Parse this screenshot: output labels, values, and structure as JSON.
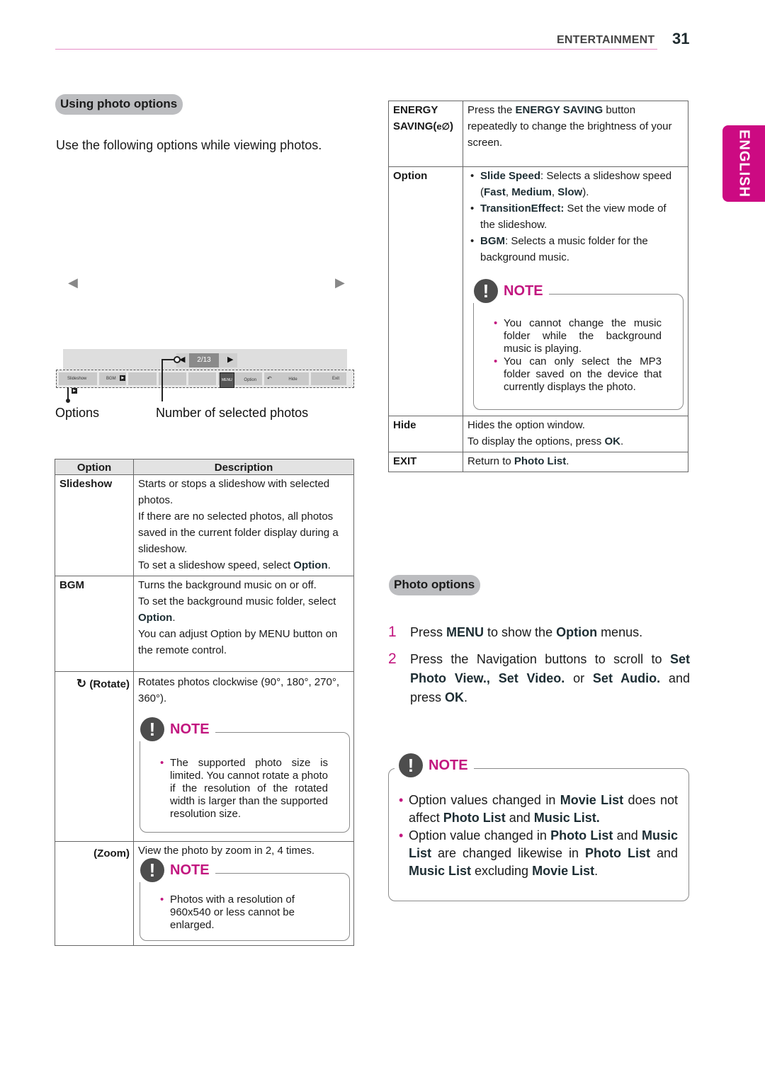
{
  "header": {
    "section": "ENTERTAINMENT",
    "page_number": "31",
    "language_tab": "ENGLISH",
    "accent_color": "#cc0a82"
  },
  "left": {
    "heading": "Using photo options",
    "intro": "Use the following options while viewing photos.",
    "viewer": {
      "prev_icon": "triangle-left",
      "next_icon": "triangle-right",
      "counter": "2/13",
      "osd_buttons": {
        "slideshow": "Slideshow",
        "bgm": "BGM",
        "menu_key": "MENU",
        "option": "Option",
        "hide": "Hide",
        "exit": "Exit"
      },
      "callout_options": "Options",
      "callout_count": "Number of selected photos"
    },
    "table": {
      "headers": [
        "Option",
        "Description"
      ],
      "rows": [
        {
          "option": "Slideshow",
          "lines": [
            "Starts or stops a slideshow with selected photos.",
            "If there are no selected photos, all photos saved in the current folder display during a slideshow.",
            "To set a slideshow speed, select ",
            "Option",
            "."
          ]
        },
        {
          "option": "BGM",
          "lines": [
            "Turns the background music on or off.",
            "To set the background music folder, select ",
            "Option",
            ".",
            "You can adjust Option by MENU button on the remote control."
          ]
        },
        {
          "option": "(Rotate)",
          "icon": "rotate-clockwise",
          "lines": [
            "Rotates photos clockwise (90°, 180°, 270°, 360°)."
          ],
          "note_title": "NOTE",
          "note_items": [
            "The supported photo size is limited. You cannot rotate a photo if the resolution of the rotated width is larger than the supported resolution size."
          ]
        },
        {
          "option": "(Zoom)",
          "lines": [
            "View the photo by zoom in 2, 4 times."
          ],
          "note_title": "NOTE",
          "note_items": [
            "Photos with a resolution of 960x540 or less cannot be enlarged."
          ]
        }
      ]
    }
  },
  "right": {
    "table": {
      "rows": [
        {
          "option_line1": "ENERGY",
          "option_line2": "SAVING(",
          "option_icon": "energy-saving",
          "option_tail": ")",
          "desc_pre": "Press the ",
          "desc_bold": "ENERGY SAVING",
          "desc_post": " button repeatedly to change the brightness of your screen."
        },
        {
          "option": "Option",
          "items": [
            {
              "bold": "Slide Speed",
              "text": ": Selects a slideshow speed (",
              "b1": "Fast",
              "s1": ", ",
              "b2": "Medium",
              "s2": ", ",
              "b3": "Slow",
              "s3": ")."
            },
            {
              "bold": "TransitionEffect:",
              "text": " Set the view mode of the slideshow."
            },
            {
              "bold": "BGM",
              "text": ": Selects a music folder for the background music."
            }
          ],
          "note_title": "NOTE",
          "note_items": [
            "You cannot change the music folder while the background music is playing.",
            "You can only select the MP3 folder saved on the device that currently displays the photo."
          ]
        },
        {
          "option": "Hide",
          "line1": "Hides the option window.",
          "line2_pre": "To display the options, press ",
          "line2_bold": "OK",
          "line2_post": "."
        },
        {
          "option": "EXIT",
          "pre": "Return to ",
          "bold": "Photo List",
          "post": "."
        }
      ]
    },
    "heading": "Photo options",
    "steps": [
      {
        "n": "1",
        "t1": "Press ",
        "b1": "MENU",
        "t2": " to show the ",
        "b2": "Option",
        "t3": " menus."
      },
      {
        "n": "2",
        "t1": "Press the Navigation buttons to scroll to ",
        "b1": "Set Photo View., Set Video.",
        "t2": " or ",
        "b2": "Set Audio.",
        "t3": " and press ",
        "b3": "OK",
        "t4": "."
      }
    ],
    "note": {
      "title": "NOTE",
      "item1": {
        "t1": "Option values changed in ",
        "b1": "Movie List",
        "t2": " does not affect ",
        "b2": "Photo List",
        "t3": " and ",
        "b3": "Music List."
      },
      "item2": {
        "t1": "Option value changed in ",
        "b1": "Photo List",
        "t2": " and ",
        "b2": "Music List",
        "t3": " are changed likewise in ",
        "b3": "Photo List",
        "t4": " and ",
        "b4": "Music List",
        "t5": " excluding ",
        "b5": "Movie List",
        "t6": "."
      }
    }
  }
}
